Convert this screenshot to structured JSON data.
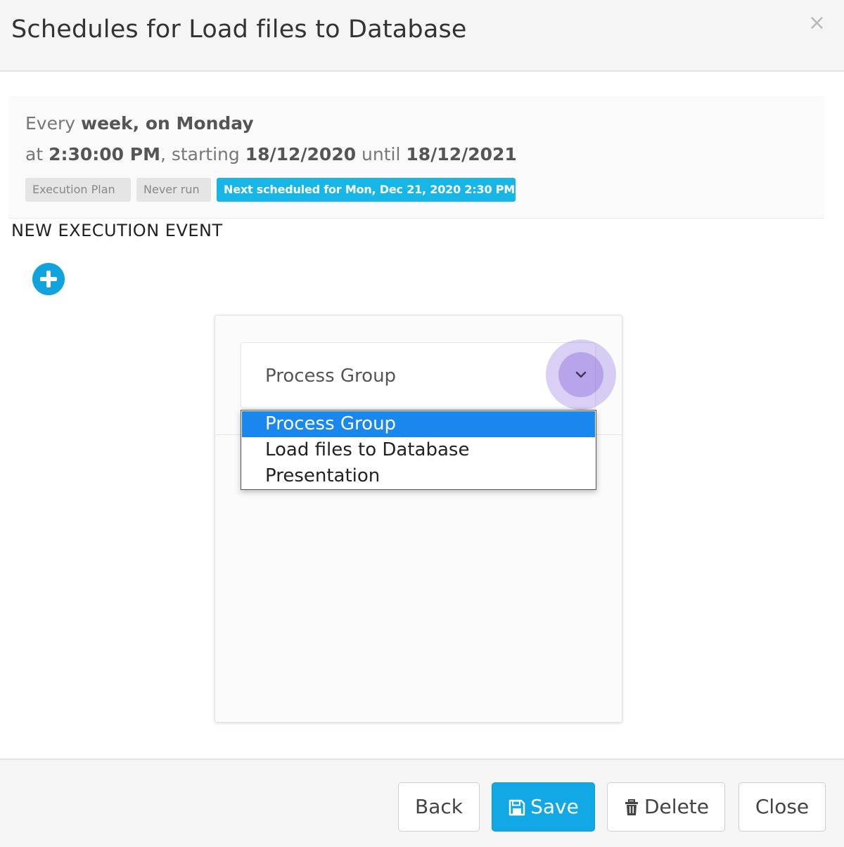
{
  "header": {
    "title": "Schedules for Load files to Database",
    "close_glyph": "×"
  },
  "summary": {
    "line1": {
      "prefix": "Every ",
      "freq": "week, on Monday"
    },
    "line2": {
      "prefix": "at ",
      "time": "2:30:00 PM",
      "mid": ", starting ",
      "start_date": "18/12/2020",
      "until": " until ",
      "end_date": "18/12/2021"
    },
    "badges": [
      {
        "label": "Execution Plan"
      },
      {
        "label": "Never run"
      },
      {
        "label": "Next scheduled for Mon, Dec 21, 2020 2:30 PM"
      }
    ]
  },
  "section": {
    "title": "NEW EXECUTION EVENT"
  },
  "select": {
    "value": "Process Group",
    "options": [
      "Process Group",
      "Load files to Database",
      "Presentation"
    ],
    "selected_index": 0
  },
  "footer": {
    "back": "Back",
    "save": "Save",
    "delete": "Delete",
    "close": "Close"
  },
  "icons": {
    "add": "plus-circle-icon",
    "chevron": "chevron-down-icon",
    "save": "floppy-disk-icon",
    "delete": "trash-icon"
  },
  "colors": {
    "accent": "#11a8e5",
    "badge_blue": "#17b6e6",
    "dropdown_selected": "#1a87ef"
  }
}
